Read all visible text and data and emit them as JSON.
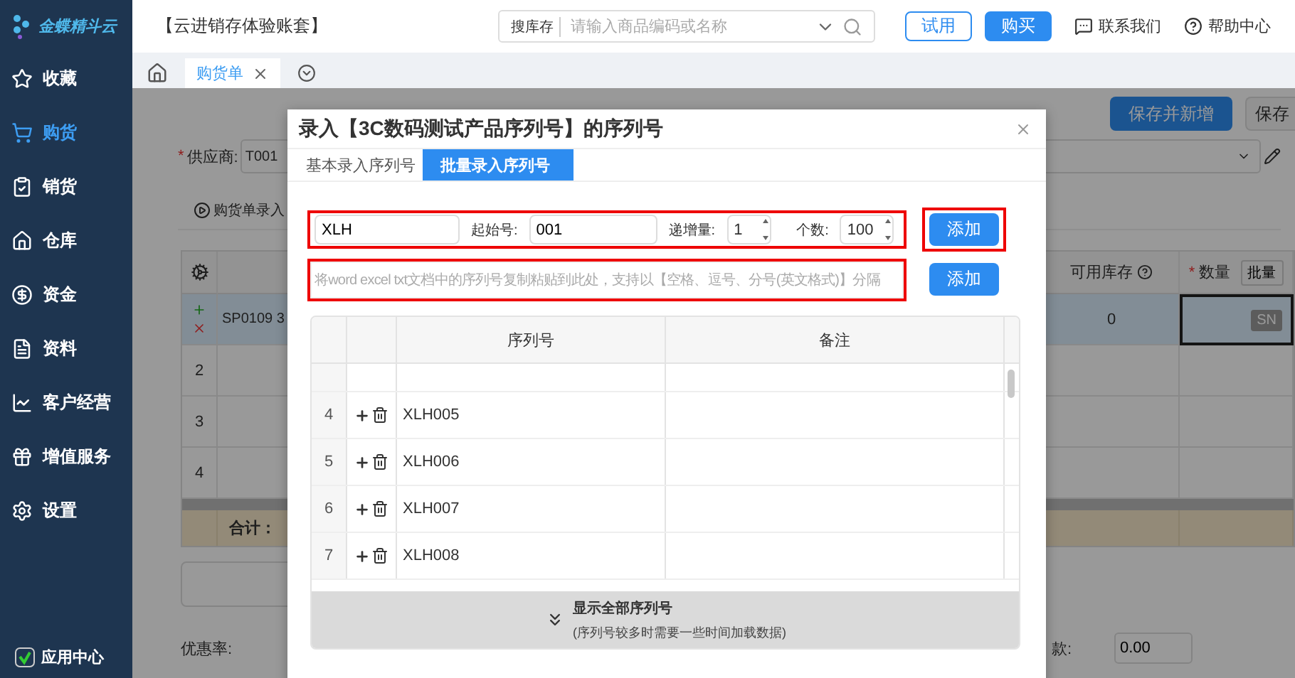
{
  "sidebar": {
    "logo": "金蝶精斗云",
    "items": [
      {
        "label": "收藏",
        "selected": false
      },
      {
        "label": "购货",
        "selected": true
      },
      {
        "label": "销货",
        "selected": false
      },
      {
        "label": "仓库",
        "selected": false
      },
      {
        "label": "资金",
        "selected": false
      },
      {
        "label": "资料",
        "selected": false
      },
      {
        "label": "客户经营",
        "selected": false
      },
      {
        "label": "增值服务",
        "selected": false
      },
      {
        "label": "设置",
        "selected": false
      }
    ],
    "footer": "应用中心"
  },
  "header": {
    "account": "【云进销存体验账套】",
    "search": {
      "scope": "搜库存",
      "placeholder": "请输入商品编码或名称"
    },
    "buttons": [
      {
        "label": "试用",
        "kind": "outline"
      },
      {
        "label": "购买",
        "kind": "primary"
      }
    ],
    "links": [
      "联系我们",
      "帮助中心"
    ]
  },
  "tabs": [
    {
      "label": "购货单",
      "selected": true
    }
  ],
  "page": {
    "actions": [
      {
        "label": "保存并新增",
        "kind": "primary"
      },
      {
        "label": "保存",
        "kind": "default"
      }
    ],
    "supplier_required_mark": "*",
    "supplier_label": "供应商:",
    "supplier_value": "T001",
    "entry_link": "购货单录入",
    "table": {
      "columns": [
        {
          "label": "可用库存",
          "help": true
        },
        {
          "label": "数量",
          "help": false,
          "required_mark": "*"
        }
      ],
      "batch_button": "批量",
      "rows": [
        {
          "number": "",
          "product": "SP0109 3",
          "stock": "0",
          "serial_badge": "SN",
          "selected": true
        },
        {
          "number": "2",
          "product": "",
          "stock": "",
          "serial_badge": "",
          "selected": false
        },
        {
          "number": "3",
          "product": "",
          "stock": "",
          "serial_badge": "",
          "selected": false
        },
        {
          "number": "4",
          "product": "",
          "stock": "",
          "serial_badge": "",
          "selected": false
        }
      ],
      "total_label": "合计："
    },
    "discount_label": "优惠率:",
    "payment_label": "款:",
    "payment_value": "0.00"
  },
  "dialog": {
    "title": "录入【3C数码测试产品序列号】的序列号",
    "tabs": [
      {
        "label": "基本录入序列号",
        "selected": false
      },
      {
        "label": "批量录入序列号",
        "selected": true
      }
    ],
    "generator": {
      "highlighted": true,
      "prefix": "XLH",
      "start_label": "起始号:",
      "start": "001",
      "step_label": "递增量:",
      "step": "1",
      "count_label": "个数:",
      "count": "100",
      "button": "添加",
      "button_highlighted": true
    },
    "paste": {
      "highlighted": true,
      "placeholder": "将word excel txt文档中的序列号复制粘贴到此处，支持以【空格、逗号、分号(英文格式)】分隔",
      "button": "添加"
    },
    "table": {
      "columns": [
        "序列号",
        "备注"
      ],
      "rows": [
        {
          "index": "4",
          "serial": "XLH005"
        },
        {
          "index": "5",
          "serial": "XLH006"
        },
        {
          "index": "6",
          "serial": "XLH007"
        },
        {
          "index": "7",
          "serial": "XLH008"
        }
      ]
    },
    "show_all": {
      "label": "显示全部序列号",
      "hint": "(序列号较多时需要一些时间加载数据)"
    }
  }
}
